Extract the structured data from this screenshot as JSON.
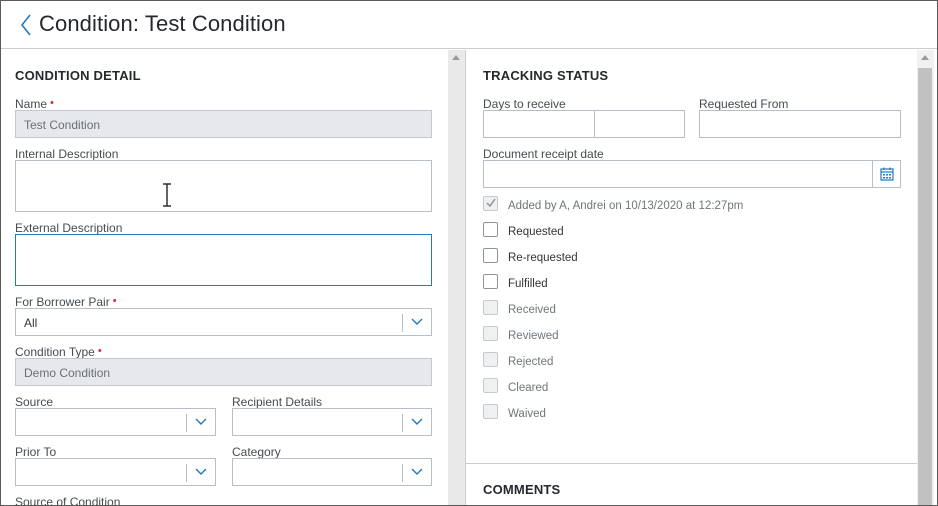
{
  "header": {
    "title": "Condition: Test Condition"
  },
  "condition_detail": {
    "section_title": "CONDITION DETAIL",
    "name": {
      "label": "Name",
      "required_mark": "•",
      "value": "Test Condition"
    },
    "internal_description": {
      "label": "Internal Description",
      "value": ""
    },
    "external_description": {
      "label": "External Description",
      "value": ""
    },
    "for_borrower_pair": {
      "label": "For Borrower Pair",
      "required_mark": "•",
      "value": "All"
    },
    "condition_type": {
      "label": "Condition Type",
      "required_mark": "•",
      "value": "Demo Condition"
    },
    "source": {
      "label": "Source",
      "value": ""
    },
    "recipient_details": {
      "label": "Recipient Details",
      "value": ""
    },
    "prior_to": {
      "label": "Prior To",
      "value": ""
    },
    "category": {
      "label": "Category",
      "value": ""
    },
    "source_of_condition": {
      "label": "Source of Condition"
    }
  },
  "tracking_status": {
    "section_title": "TRACKING STATUS",
    "days_to_receive": {
      "label": "Days to receive",
      "value": ""
    },
    "requested_from": {
      "label": "Requested From",
      "value": ""
    },
    "document_receipt_date": {
      "label": "Document receipt date",
      "value": ""
    },
    "statuses": [
      {
        "label": "Added by A, Andrei on 10/13/2020 at 12:27pm",
        "checked": true,
        "disabled": true
      },
      {
        "label": "Requested",
        "checked": false,
        "disabled": false
      },
      {
        "label": "Re-requested",
        "checked": false,
        "disabled": false
      },
      {
        "label": "Fulfilled",
        "checked": false,
        "disabled": false
      },
      {
        "label": "Received",
        "checked": false,
        "disabled": true
      },
      {
        "label": "Reviewed",
        "checked": false,
        "disabled": true
      },
      {
        "label": "Rejected",
        "checked": false,
        "disabled": true
      },
      {
        "label": "Cleared",
        "checked": false,
        "disabled": true
      },
      {
        "label": "Waived",
        "checked": false,
        "disabled": true
      }
    ]
  },
  "comments": {
    "section_title": "COMMENTS"
  },
  "colors": {
    "accent": "#1e79c2",
    "required": "#e0242f",
    "disabled_bg": "#e6e8eb"
  },
  "icons": [
    "back-chevron-icon",
    "chevron-down-icon",
    "calendar-icon",
    "checkmark-icon",
    "text-cursor-icon"
  ]
}
